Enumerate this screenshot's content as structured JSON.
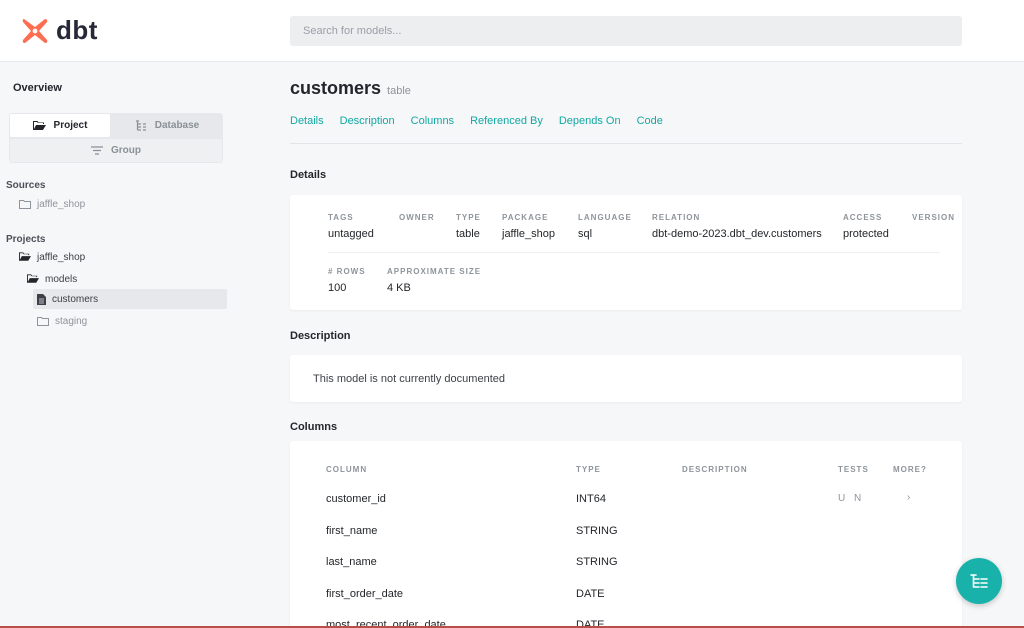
{
  "header": {
    "logo_text": "dbt",
    "search_placeholder": "Search for models..."
  },
  "colors": {
    "brand_orange": "#fe6d4f",
    "accent_teal": "#12a8a3"
  },
  "sidebar": {
    "overview": "Overview",
    "segments": {
      "project": "Project",
      "database": "Database",
      "group": "Group"
    },
    "sources_heading": "Sources",
    "sources": [
      {
        "label": "jaffle_shop",
        "icon": "folder-outline-icon"
      }
    ],
    "projects_heading": "Projects",
    "projects": [
      {
        "label": "jaffle_shop",
        "icon": "folder-open-icon"
      },
      {
        "label": "models",
        "icon": "folder-open-icon"
      },
      {
        "label": "customers",
        "icon": "file-icon",
        "active": true
      },
      {
        "label": "staging",
        "icon": "folder-outline-icon"
      }
    ]
  },
  "main": {
    "title": "customers",
    "subtitle": "table",
    "tabs": [
      "Details",
      "Description",
      "Columns",
      "Referenced By",
      "Depends On",
      "Code"
    ],
    "details": {
      "heading": "Details",
      "fields": [
        {
          "label": "TAGS",
          "value": "untagged"
        },
        {
          "label": "OWNER",
          "value": ""
        },
        {
          "label": "TYPE",
          "value": "table"
        },
        {
          "label": "PACKAGE",
          "value": "jaffle_shop"
        },
        {
          "label": "LANGUAGE",
          "value": "sql"
        },
        {
          "label": "RELATION",
          "value": "dbt-demo-2023.dbt_dev.customers"
        },
        {
          "label": "ACCESS",
          "value": "protected"
        },
        {
          "label": "VERSION",
          "value": ""
        }
      ],
      "stats": [
        {
          "label": "# ROWS",
          "value": "100"
        },
        {
          "label": "APPROXIMATE SIZE",
          "value": "4 KB"
        }
      ]
    },
    "description": {
      "heading": "Description",
      "text": "This model is not currently documented"
    },
    "columns": {
      "heading": "Columns",
      "headers": [
        "COLUMN",
        "TYPE",
        "DESCRIPTION",
        "TESTS",
        "MORE?"
      ],
      "rows": [
        {
          "name": "customer_id",
          "type": "INT64",
          "description": "",
          "tests": "U N",
          "more": "›"
        },
        {
          "name": "first_name",
          "type": "STRING",
          "description": "",
          "tests": "",
          "more": ""
        },
        {
          "name": "last_name",
          "type": "STRING",
          "description": "",
          "tests": "",
          "more": ""
        },
        {
          "name": "first_order_date",
          "type": "DATE",
          "description": "",
          "tests": "",
          "more": ""
        },
        {
          "name": "most_recent_order_date",
          "type": "DATE",
          "description": "",
          "tests": "",
          "more": ""
        }
      ]
    }
  },
  "fab_icon": "lineage-graph-icon"
}
